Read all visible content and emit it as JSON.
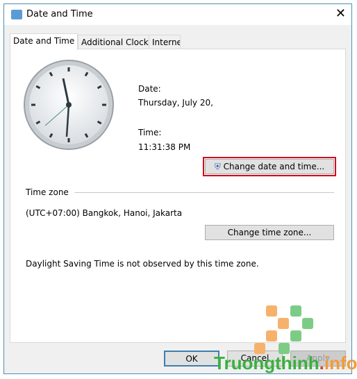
{
  "window": {
    "title": "Date and Time",
    "icon": "date-time-app-icon",
    "close_icon": "close-icon"
  },
  "tabs": [
    {
      "label": "Date and Time",
      "active": true
    },
    {
      "label": "Additional Clocks"
    },
    {
      "label": "Internet Time"
    }
  ],
  "datetime": {
    "date_label": "Date:",
    "date_value": "Thursday, July 20,",
    "time_label": "Time:",
    "time_value": "11:31:38 PM",
    "change_button": "Change date and time...",
    "shield_icon": "uac-shield-icon"
  },
  "timezone": {
    "heading": "Time zone",
    "value": "(UTC+07:00) Bangkok, Hanoi, Jakarta",
    "change_button": "Change time zone...",
    "dst_note": "Daylight Saving Time is not observed by this time zone."
  },
  "footer": {
    "ok": "OK",
    "cancel": "Cancel",
    "apply": "Apply"
  },
  "watermark": {
    "text_main": "Truongthinh",
    "text_dot": ".",
    "text_info": "info"
  },
  "colors": {
    "highlight": "#d0021b",
    "accent": "#4a8fb5"
  }
}
